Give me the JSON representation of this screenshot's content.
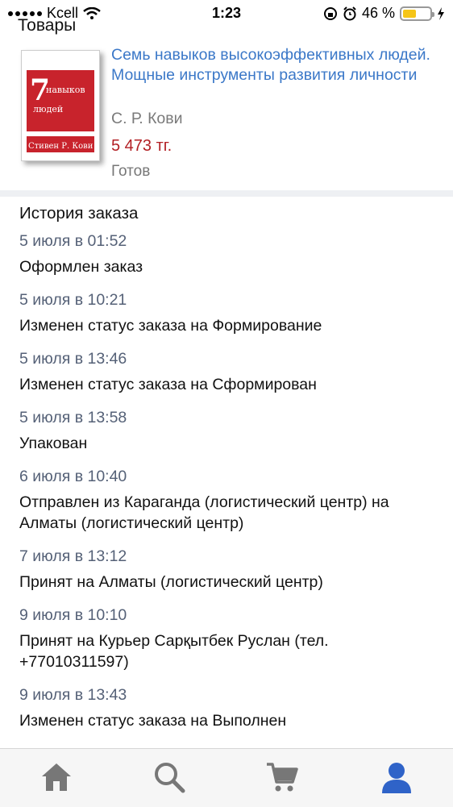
{
  "status_bar": {
    "carrier": "Kcell",
    "time": "1:23",
    "battery_percent": "46 %",
    "battery_level": 0.46
  },
  "goods": {
    "title": "Товары",
    "product": {
      "title": "Семь навыков высокоэффективных людей. Мощные инструменты развития личности",
      "author": "С. Р. Кови",
      "price": "5 473 тг.",
      "status": "Готов"
    }
  },
  "history": {
    "title": "История заказа",
    "events": [
      {
        "date": "5 июля в 01:52",
        "text": "Оформлен заказ"
      },
      {
        "date": "5 июля в 10:21",
        "text": "Изменен статус заказа на Формирование"
      },
      {
        "date": "5 июля в 13:46",
        "text": "Изменен статус заказа на Сформирован"
      },
      {
        "date": "5 июля в 13:58",
        "text": "Упакован"
      },
      {
        "date": "6 июля в 10:40",
        "text": "Отправлен из Караганда (логистический центр) на Алматы (логистический центр)"
      },
      {
        "date": "7 июля в 13:12",
        "text": "Принят на Алматы (логистический центр)"
      },
      {
        "date": "9 июля в 10:10",
        "text": "Принят на Курьер Сарқытбек Руслан (тел. +77010311597)"
      },
      {
        "date": "9 июля в 13:43",
        "text": "Изменен статус заказа на Выполнен"
      }
    ]
  },
  "tabbar": {
    "icon_color": "#777777",
    "active_color": "#2f63c8",
    "tabs": [
      {
        "icon": "home-icon"
      },
      {
        "icon": "search-icon"
      },
      {
        "icon": "cart-icon"
      },
      {
        "icon": "profile-icon",
        "active": true
      }
    ]
  }
}
